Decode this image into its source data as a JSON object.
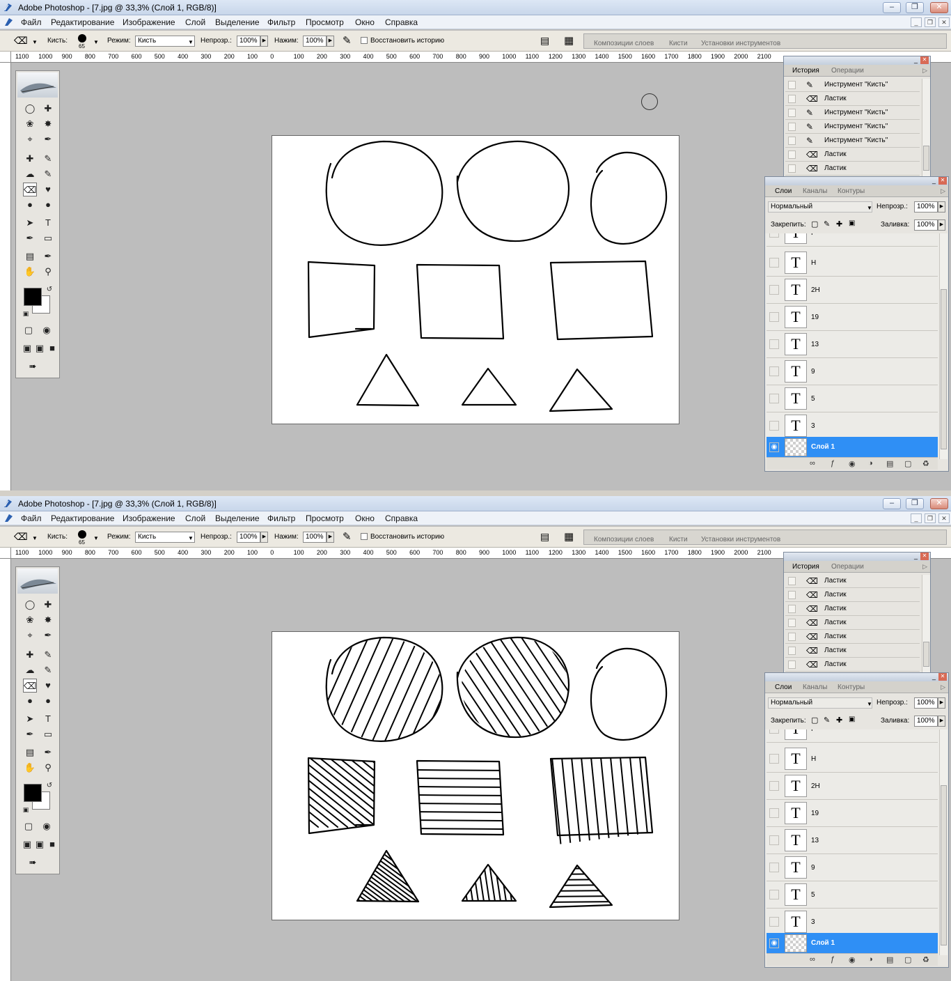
{
  "windows": [
    {
      "title": "Adobe Photoshop - [7.jpg @ 33,3% (Слой 1, RGB/8)]",
      "hatched": false,
      "history_items": [
        {
          "icon": "brush-icon",
          "label": "Инструмент \"Кисть\""
        },
        {
          "icon": "eraser-icon",
          "label": "Ластик"
        },
        {
          "icon": "brush-icon",
          "label": "Инструмент \"Кисть\""
        },
        {
          "icon": "brush-icon",
          "label": "Инструмент \"Кисть\""
        },
        {
          "icon": "brush-icon",
          "label": "Инструмент \"Кисть\""
        },
        {
          "icon": "eraser-icon",
          "label": "Ластик"
        },
        {
          "icon": "eraser-icon",
          "label": "Ластик"
        }
      ]
    },
    {
      "title": "Adobe Photoshop - [7.jpg @ 33,3% (Слой 1, RGB/8)]",
      "hatched": true,
      "history_items": [
        {
          "icon": "eraser-icon",
          "label": "Ластик"
        },
        {
          "icon": "eraser-icon",
          "label": "Ластик"
        },
        {
          "icon": "eraser-icon",
          "label": "Ластик"
        },
        {
          "icon": "eraser-icon",
          "label": "Ластик"
        },
        {
          "icon": "eraser-icon",
          "label": "Ластик"
        },
        {
          "icon": "eraser-icon",
          "label": "Ластик"
        },
        {
          "icon": "eraser-icon",
          "label": "Ластик"
        }
      ]
    }
  ],
  "menu": [
    "Файл",
    "Редактирование",
    "Изображение",
    "Слой",
    "Выделение",
    "Фильтр",
    "Просмотр",
    "Окно",
    "Справка"
  ],
  "options": {
    "brush_label": "Кисть:",
    "brush_size": "65",
    "mode_label": "Режим:",
    "mode_value": "Кисть",
    "opacity_label": "Непрозр.:",
    "opacity_value": "100%",
    "flow_label": "Нажим:",
    "flow_value": "100%",
    "restore_history_label": "Восстановить историю"
  },
  "palette_well_tabs": [
    "Композиции слоев",
    "Кисти",
    "Установки инструментов"
  ],
  "ruler_marks": [
    "1100",
    "1000",
    "900",
    "800",
    "700",
    "600",
    "500",
    "400",
    "300",
    "200",
    "100",
    "0",
    "100",
    "200",
    "300",
    "400",
    "500",
    "600",
    "700",
    "800",
    "900",
    "1000",
    "1100",
    "1200",
    "1300",
    "1400",
    "1500",
    "1600",
    "1700",
    "1800",
    "1900",
    "2000",
    "2100"
  ],
  "history_panel": {
    "tabs": [
      "История",
      "Операции"
    ]
  },
  "layers_panel": {
    "tabs": [
      "Слои",
      "Каналы",
      "Контуры"
    ],
    "blend_mode": "Нормальный",
    "opacity_label": "Непрозр.:",
    "opacity_value": "100%",
    "lock_label": "Закрепить:",
    "fill_label": "Заливка:",
    "fill_value": "100%",
    "layers": [
      {
        "name": "F",
        "type": "text"
      },
      {
        "name": "H",
        "type": "text"
      },
      {
        "name": "2H",
        "type": "text"
      },
      {
        "name": "19",
        "type": "text"
      },
      {
        "name": "13",
        "type": "text"
      },
      {
        "name": "9",
        "type": "text"
      },
      {
        "name": "5",
        "type": "text"
      },
      {
        "name": "3",
        "type": "text"
      },
      {
        "name": "Слой 1",
        "type": "raster",
        "selected": true,
        "visible": true
      }
    ]
  },
  "colors": {
    "foreground": "#000000",
    "background": "#ffffff",
    "selection": "#2f8ff5"
  }
}
